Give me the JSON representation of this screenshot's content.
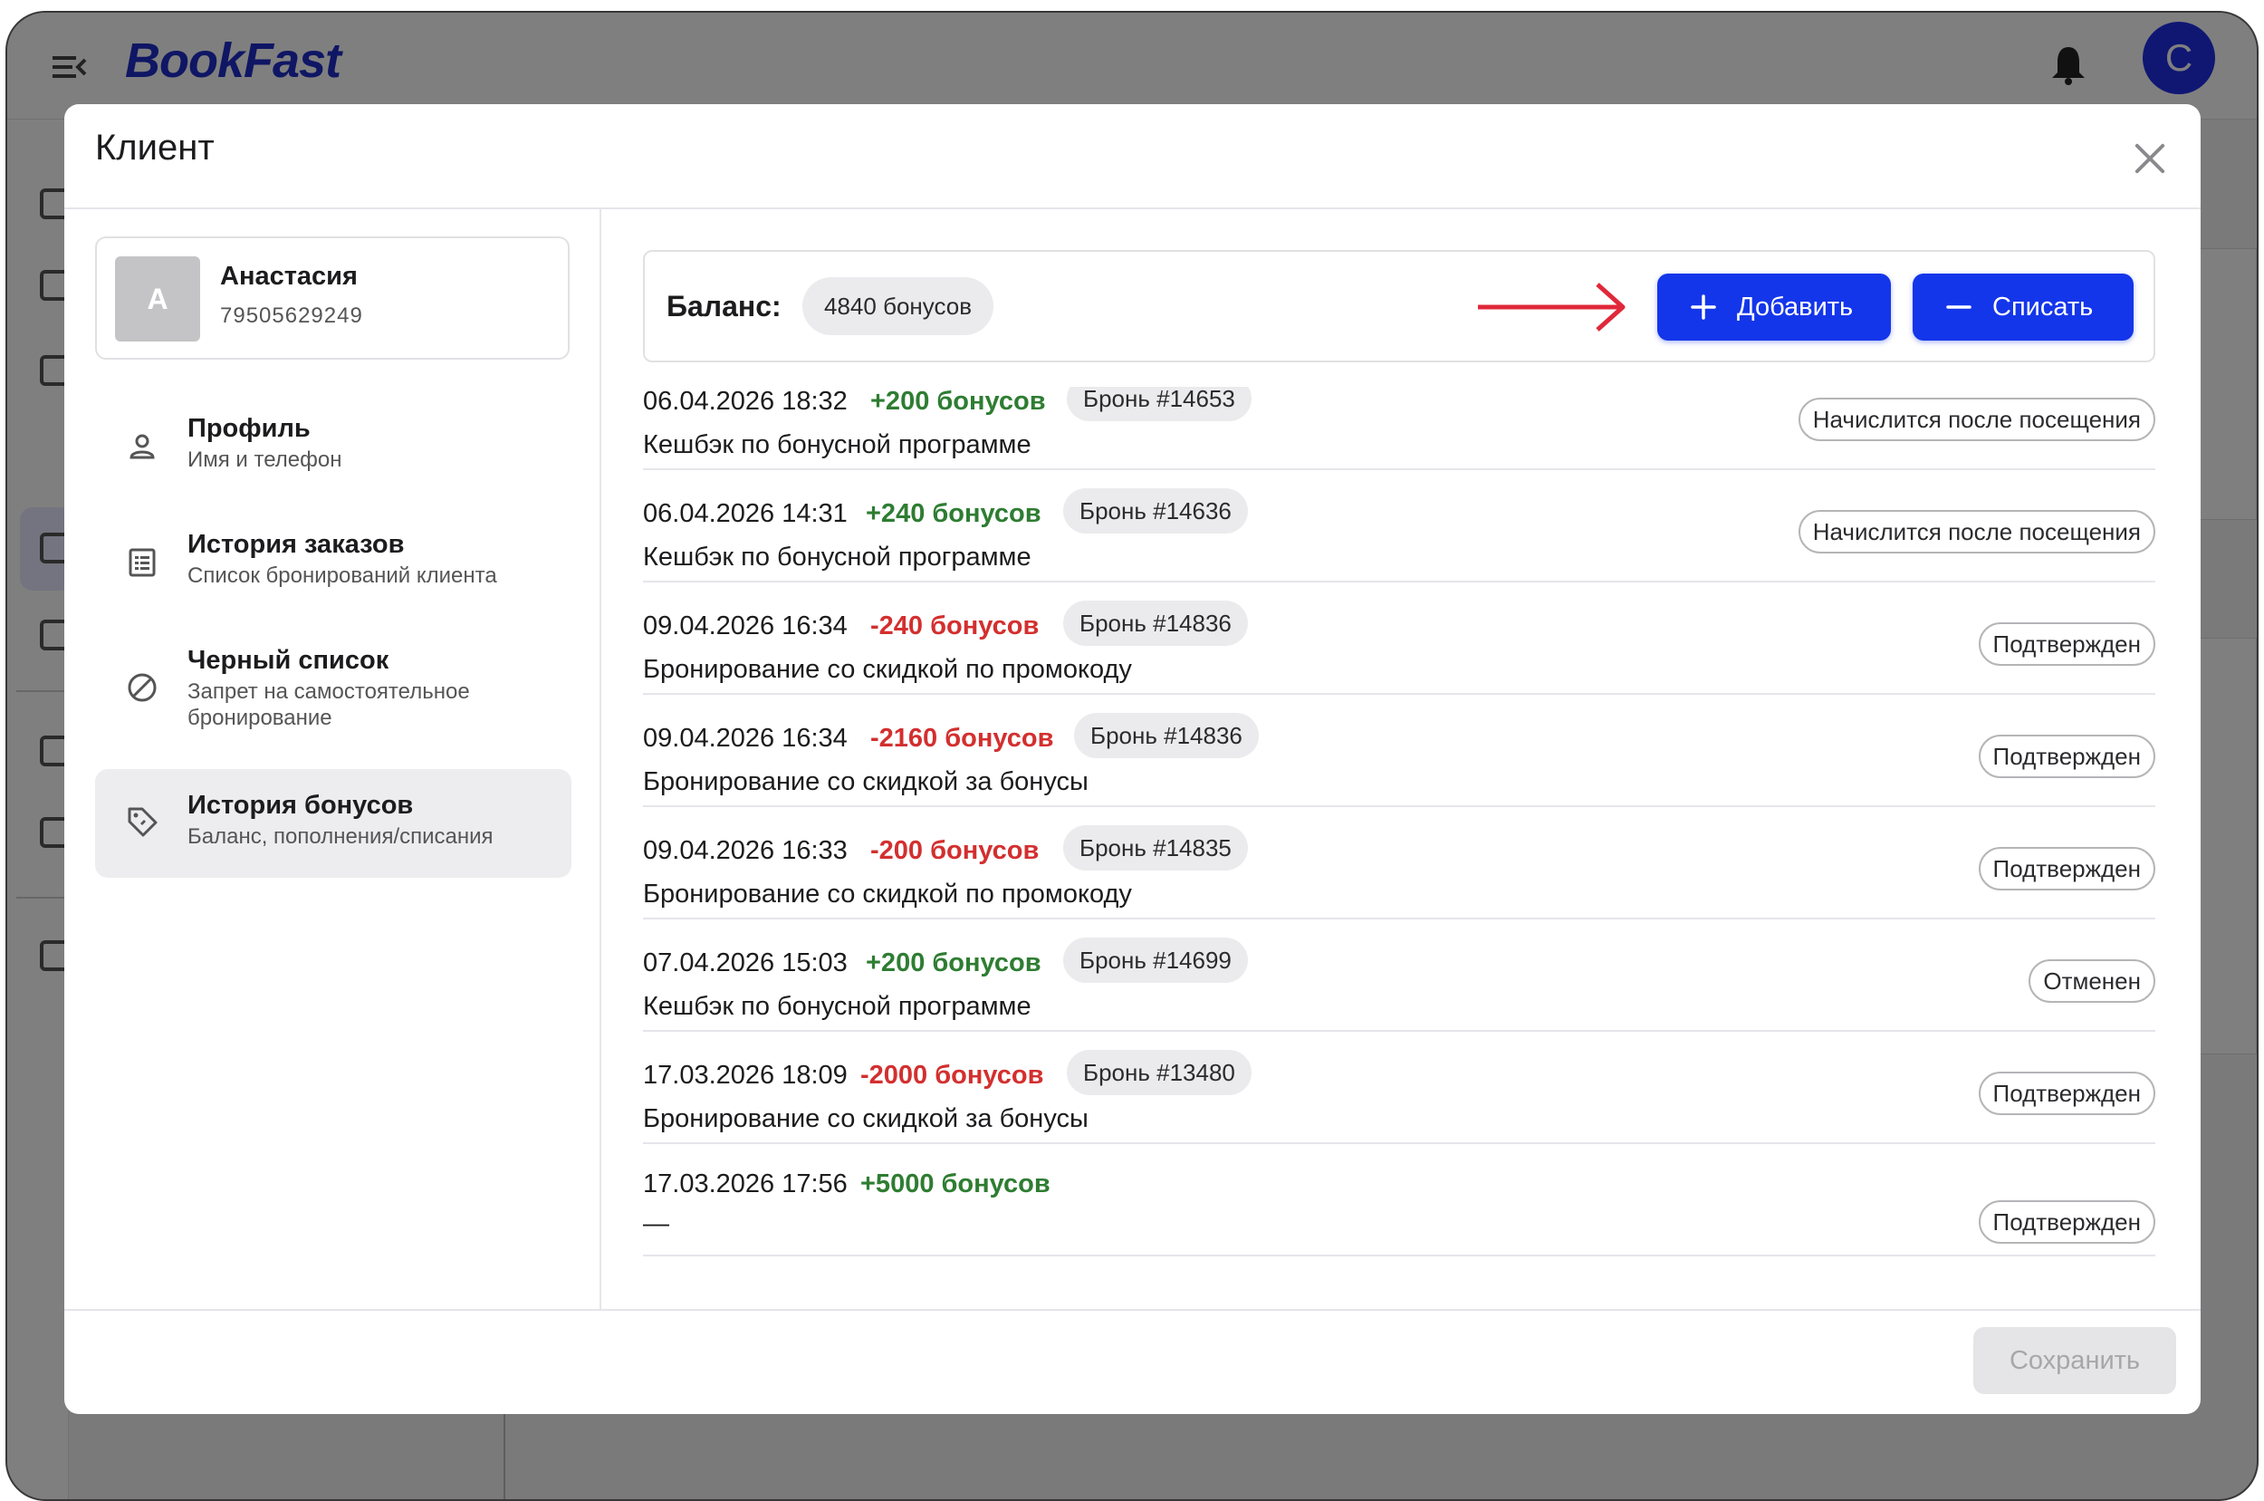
{
  "app": {
    "logo": "BookFast",
    "user_initial": "C"
  },
  "modal": {
    "title": "Клиент",
    "save_label": "Сохранить"
  },
  "client": {
    "initial": "А",
    "name": "Анастасия",
    "phone": "79505629249"
  },
  "nav": [
    {
      "title": "Профиль",
      "subtitle": "Имя и телефон",
      "icon": "person-icon"
    },
    {
      "title": "История заказов",
      "subtitle": "Список бронирований клиента",
      "icon": "list-icon"
    },
    {
      "title": "Черный список",
      "subtitle": "Запрет на самостоятельное бронирование",
      "icon": "ban-icon"
    },
    {
      "title": "История бонусов",
      "subtitle": "Баланс, пополнения/списания",
      "icon": "tag-icon",
      "active": true
    }
  ],
  "balance": {
    "label": "Баланс:",
    "value": "4840 бонусов",
    "add_label": "Добавить",
    "subtract_label": "Списать"
  },
  "history": [
    {
      "date": "06.04.2026 18:32",
      "amount": "+200 бонусов",
      "sign": "pos",
      "booking": "Бронь #14653",
      "description": "Кешбэк по бонусной программе",
      "status": "Начислится после посещения"
    },
    {
      "date": "06.04.2026 14:31",
      "amount": "+240 бонусов",
      "sign": "pos",
      "booking": "Бронь #14636",
      "description": "Кешбэк по бонусной программе",
      "status": "Начислится после посещения"
    },
    {
      "date": "09.04.2026 16:34",
      "amount": "-240 бонусов",
      "sign": "neg",
      "booking": "Бронь #14836",
      "description": "Бронирование со скидкой по промокоду",
      "status": "Подтвержден"
    },
    {
      "date": "09.04.2026 16:34",
      "amount": "-2160 бонусов",
      "sign": "neg",
      "booking": "Бронь #14836",
      "description": "Бронирование со скидкой за бонусы",
      "status": "Подтвержден"
    },
    {
      "date": "09.04.2026 16:33",
      "amount": "-200 бонусов",
      "sign": "neg",
      "booking": "Бронь #14835",
      "description": "Бронирование со скидкой по промокоду",
      "status": "Подтвержден"
    },
    {
      "date": "07.04.2026 15:03",
      "amount": "+200 бонусов",
      "sign": "pos",
      "booking": "Бронь #14699",
      "description": "Кешбэк по бонусной программе",
      "status": "Отменен"
    },
    {
      "date": "17.03.2026 18:09",
      "amount": "-2000 бонусов",
      "sign": "neg",
      "booking": "Бронь #13480",
      "description": "Бронирование со скидкой за бонусы",
      "status": "Подтвержден"
    },
    {
      "date": "17.03.2026 17:56",
      "amount": "+5000 бонусов",
      "sign": "pos",
      "booking": "",
      "description": "—",
      "status": "Подтвержден"
    }
  ],
  "colors": {
    "accent": "#1436ea",
    "positive": "#2e7d32",
    "negative": "#d32f2f",
    "annotation_arrow": "#e0283a"
  }
}
